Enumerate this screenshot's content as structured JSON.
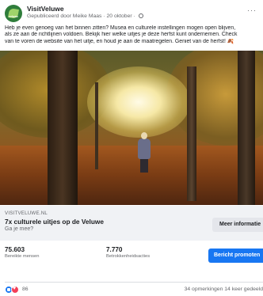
{
  "post": {
    "page_name": "VisitVeluwe",
    "published_by": "Gepubliceerd door Meike Maas",
    "date": "20 oktober",
    "avatar_text": "veluwe",
    "text_lines": [
      "Heb je even genoeg van het binnen zitten? Musea en culturele instellingen mogen open blijven,",
      "als ze aan de richtlijnen voldoen. Bekijk hier welke uitjes je deze herfst kunt ondernemen. Check",
      "van te voren de website van het uitje, en houd je aan de maatregelen. Geniet van de herfst! 🍂"
    ]
  },
  "link": {
    "domain": "VISITVELUWE.NL",
    "title": "7x culturele uitjes op de Veluwe",
    "subtitle": "Ga je mee?",
    "button_label": "Meer informatie"
  },
  "stats": {
    "reached_value": "75.603",
    "reached_label": "Bereikte mensen",
    "engagement_value": "7.770",
    "engagement_label": "Betrokkenheidsacties",
    "boost_label": "Bericht promoten"
  },
  "footer": {
    "reaction_count": "86",
    "comments_shares": "34 opmerkingen  14 keer gedeeld"
  },
  "colors": {
    "accent": "#1877f2",
    "like": "#1877f2",
    "love": "#f33e58"
  }
}
